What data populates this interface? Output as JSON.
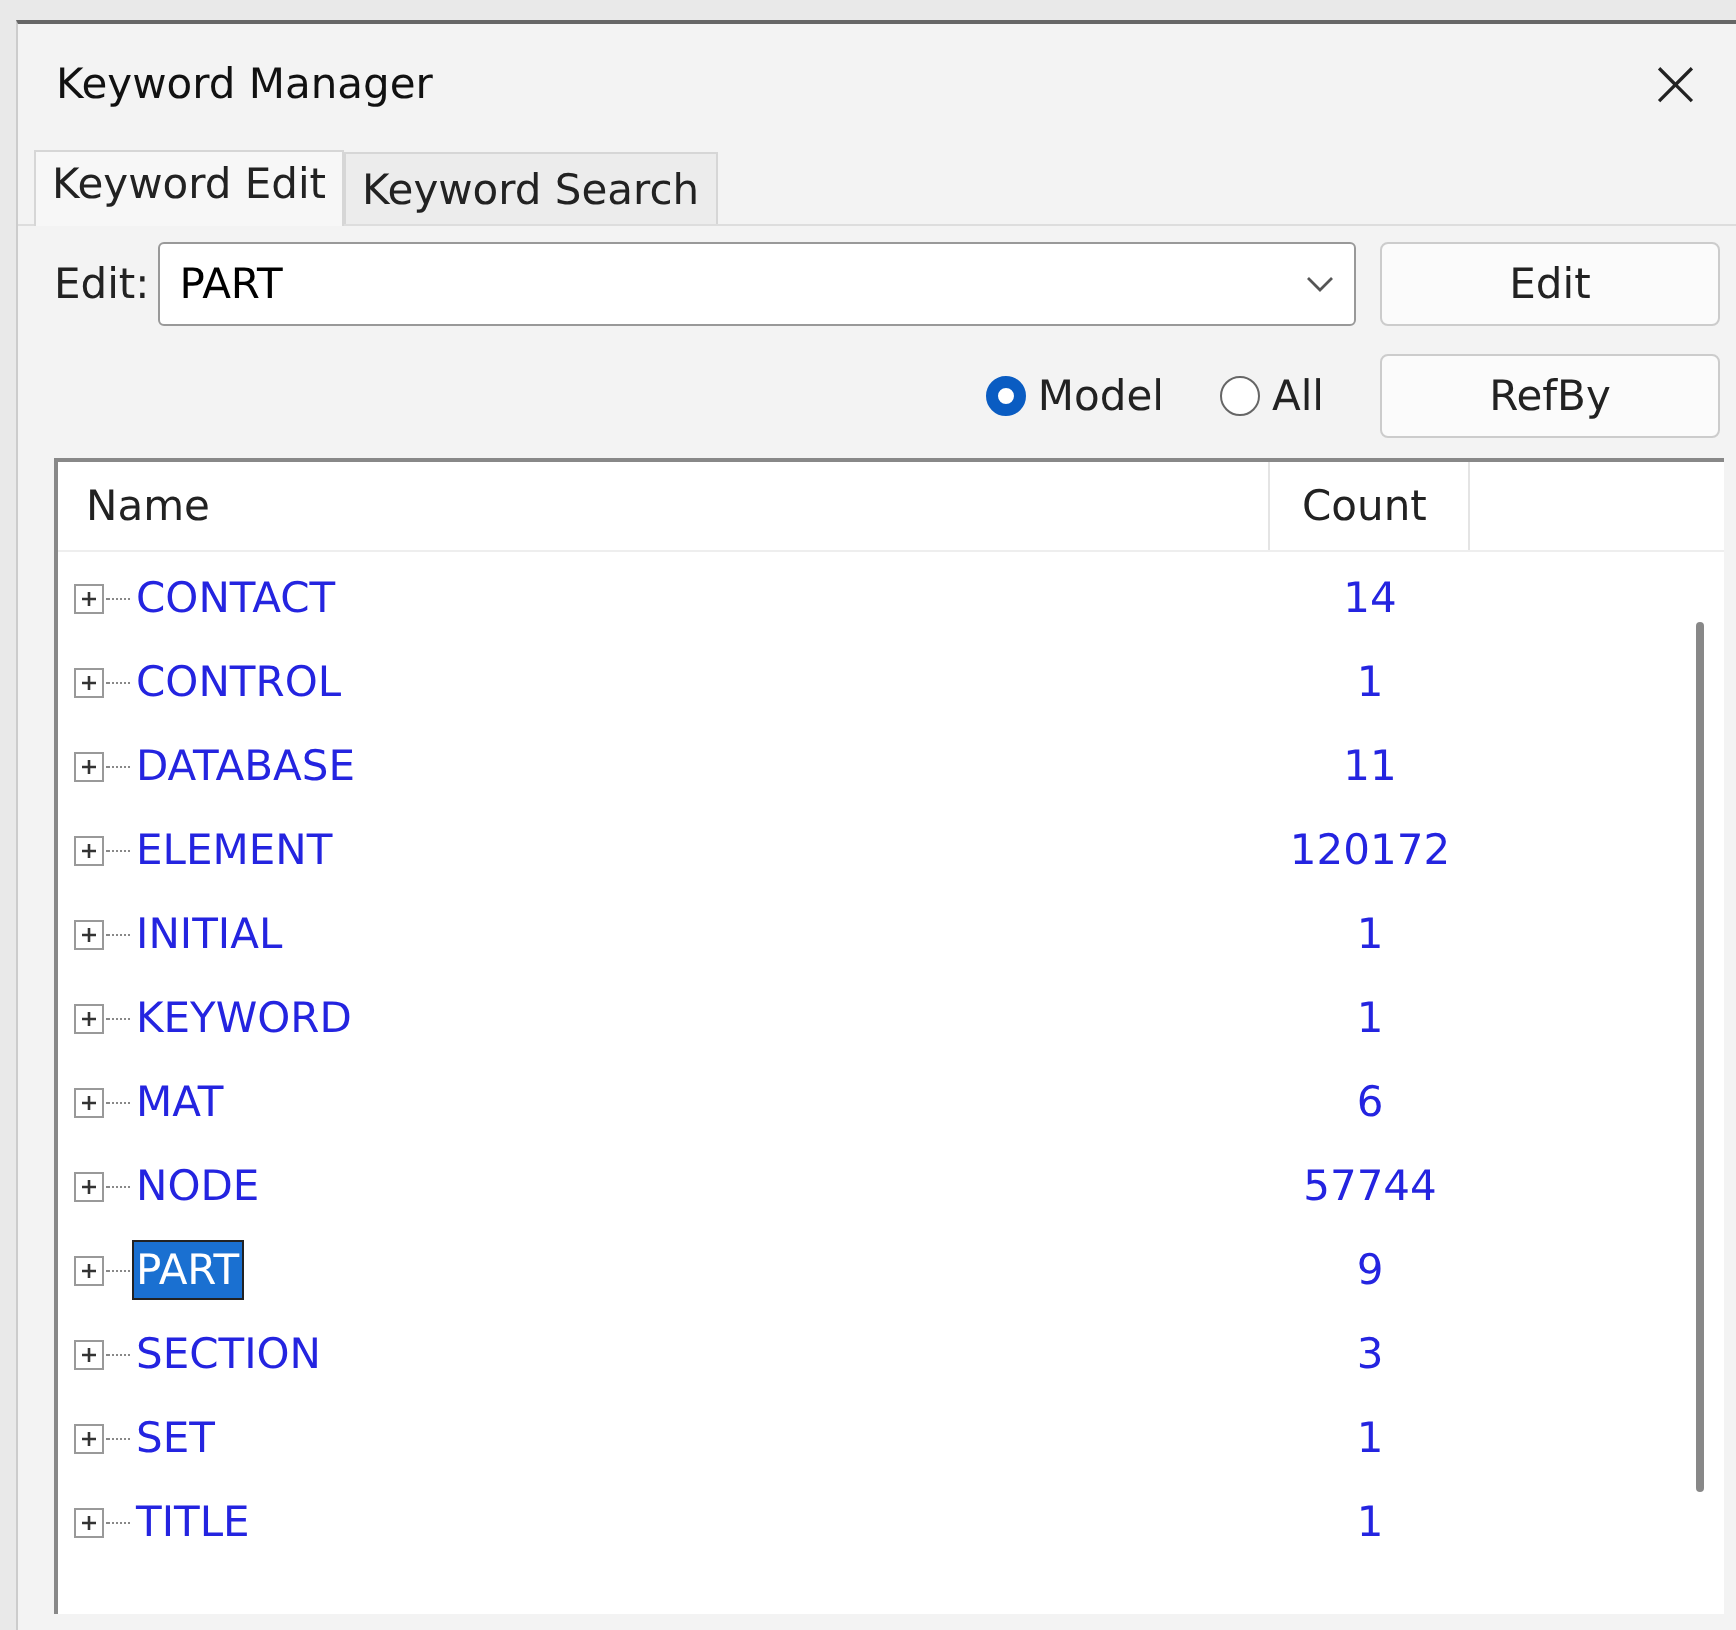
{
  "window": {
    "title": "Keyword Manager",
    "close": "×"
  },
  "tabs": [
    {
      "label": "Keyword Edit",
      "selected": true
    },
    {
      "label": "Keyword Search",
      "selected": false
    }
  ],
  "edit": {
    "label": "Edit:",
    "value": "PART",
    "button": "Edit"
  },
  "scope": [
    {
      "label": "Model",
      "selected": true
    },
    {
      "label": "All",
      "selected": false
    }
  ],
  "refby_button": "RefBy",
  "table": {
    "columns": [
      "Name",
      "Count"
    ],
    "rows": [
      {
        "name": "CONTACT",
        "count": "14",
        "selected": false
      },
      {
        "name": "CONTROL",
        "count": "1",
        "selected": false
      },
      {
        "name": "DATABASE",
        "count": "11",
        "selected": false
      },
      {
        "name": "ELEMENT",
        "count": "120172",
        "selected": false
      },
      {
        "name": "INITIAL",
        "count": "1",
        "selected": false
      },
      {
        "name": "KEYWORD",
        "count": "1",
        "selected": false
      },
      {
        "name": "MAT",
        "count": "6",
        "selected": false
      },
      {
        "name": "NODE",
        "count": "57744",
        "selected": false
      },
      {
        "name": "PART",
        "count": "9",
        "selected": true
      },
      {
        "name": "SECTION",
        "count": "3",
        "selected": false
      },
      {
        "name": "SET",
        "count": "1",
        "selected": false
      },
      {
        "name": "TITLE",
        "count": "1",
        "selected": false
      }
    ]
  }
}
